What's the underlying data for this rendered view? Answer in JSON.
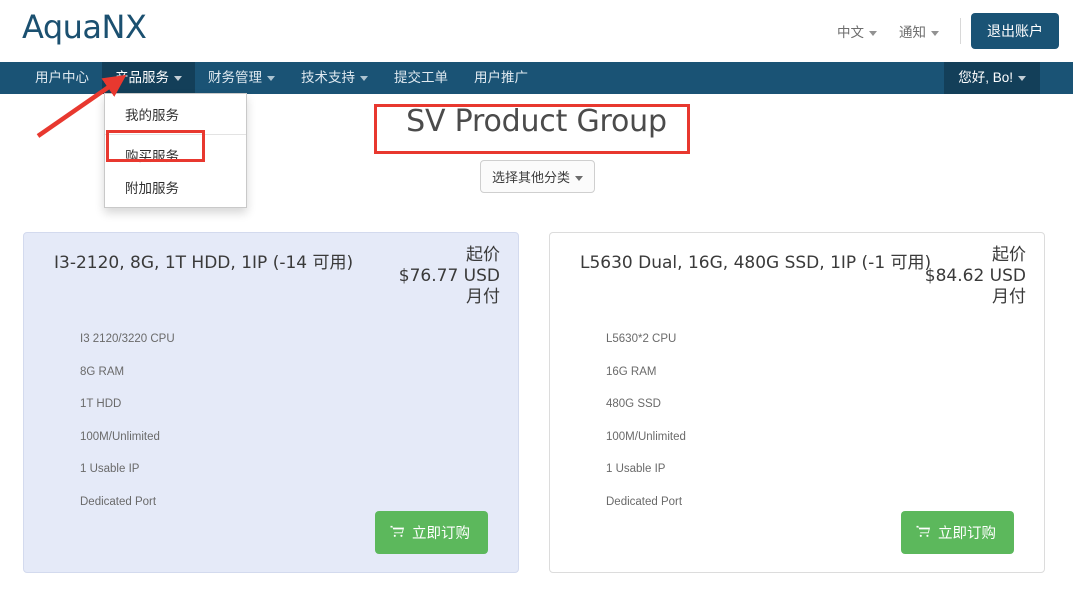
{
  "brand": {
    "name": "AquaNX"
  },
  "topbar": {
    "language": "中文",
    "notifications": "通知",
    "logout_label": "退出账户"
  },
  "nav": {
    "items": [
      {
        "label": "用户中心",
        "has_caret": false,
        "active": false
      },
      {
        "label": "产品服务",
        "has_caret": true,
        "active": true
      },
      {
        "label": "财务管理",
        "has_caret": true,
        "active": false
      },
      {
        "label": "技术支持",
        "has_caret": true,
        "active": false
      },
      {
        "label": "提交工单",
        "has_caret": false,
        "active": false
      },
      {
        "label": "用户推广",
        "has_caret": false,
        "active": false
      }
    ],
    "user_greeting": "您好, Bo!"
  },
  "dropdown": {
    "items": [
      {
        "label": "我的服务",
        "highlighted": false
      },
      {
        "label": "购买服务",
        "highlighted": true
      },
      {
        "label": "附加服务",
        "highlighted": false
      }
    ]
  },
  "main": {
    "title": "SV Product Group",
    "category_button": "选择其他分类"
  },
  "products": [
    {
      "name": "I3-2120, 8G, 1T HDD, 1IP (-14 可用)",
      "price_prefix": "起价",
      "price": "$76.77 USD",
      "price_period": "月付",
      "features": [
        "I3 2120/3220 CPU",
        "8G RAM",
        "1T HDD",
        "100M/Unlimited",
        "1 Usable IP",
        "Dedicated Port"
      ],
      "order_label": "立即订购"
    },
    {
      "name": "L5630 Dual, 16G, 480G SSD, 1IP (-1 可用)",
      "price_prefix": "起价",
      "price": "$84.62 USD",
      "price_period": "月付",
      "features": [
        "L5630*2 CPU",
        "16G RAM",
        "480G SSD",
        "100M/Unlimited",
        "1 Usable IP",
        "Dedicated Port"
      ],
      "order_label": "立即订购"
    }
  ],
  "colors": {
    "nav_background": "#1a5375",
    "nav_active": "#133f59",
    "logo": "#1b5070",
    "order_button": "#5cb85c",
    "annotation_red": "#e8382f",
    "card_highlight_bg": "#e5eaf8"
  },
  "icons": {
    "cart": "🛒",
    "caret": "▾"
  }
}
